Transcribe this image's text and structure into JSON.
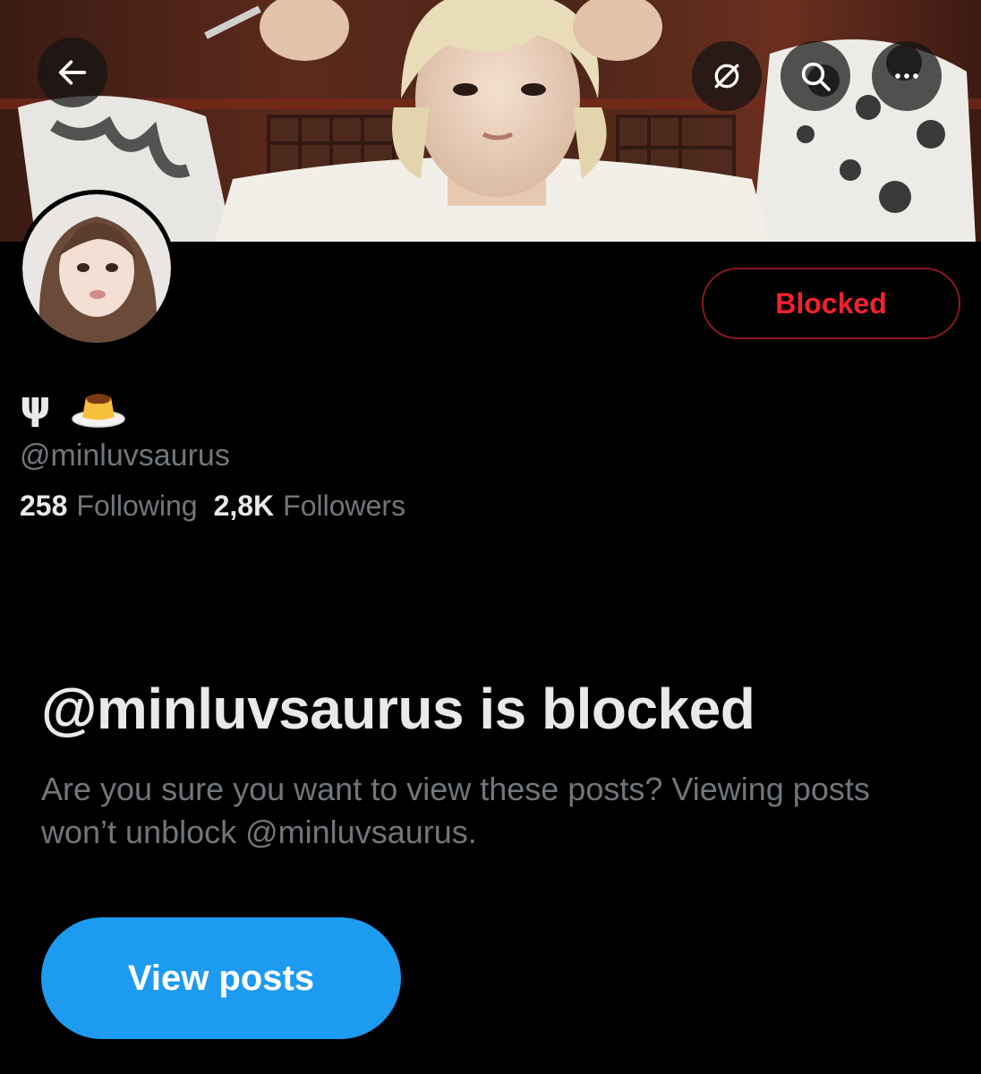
{
  "header": {
    "back_icon": "arrow-left-icon",
    "grok_icon": "slashed-circle-icon",
    "search_icon": "search-icon",
    "more_icon": "more-horizontal-icon"
  },
  "profile": {
    "display_name_symbol": "ψ",
    "display_name_emoji_icon": "pudding-icon",
    "handle": "@minluvsaurus",
    "following_count": "258",
    "following_label": "Following",
    "followers_count": "2,8K",
    "followers_label": "Followers",
    "blocked_button_label": "Blocked"
  },
  "blocked_notice": {
    "title": "@minluvsaurus is blocked",
    "description": "Are you sure you want to view these posts? Viewing posts won’t unblock @minluvsaurus.",
    "view_posts_label": "View posts"
  },
  "colors": {
    "background": "#000000",
    "primary_text": "#e7e9ea",
    "secondary_text": "#71767b",
    "accent_blue": "#1d9bf0",
    "blocked_red": "#f4212e"
  }
}
